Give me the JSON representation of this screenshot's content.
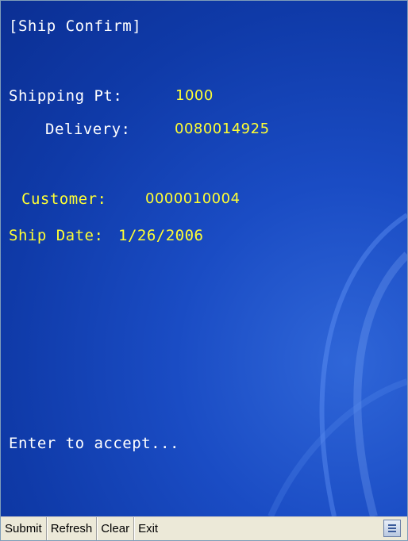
{
  "screen": {
    "title": "[Ship Confirm]",
    "shipping_pt_label": "Shipping Pt:",
    "shipping_pt_value": "1000",
    "delivery_label": "Delivery:",
    "delivery_value": "0080014925",
    "customer_label": "Customer:",
    "customer_value": "0000010004",
    "ship_date_label": "Ship Date:",
    "ship_date_value": "1/26/2006",
    "prompt": "Enter to accept..."
  },
  "taskbar": {
    "submit_label": "Submit",
    "refresh_label": "Refresh",
    "clear_label": "Clear",
    "exit_label": "Exit",
    "input_panel_icon": "keyboard-icon"
  },
  "colors": {
    "background": "#1a4cc4",
    "label_text": "#ffffff",
    "value_text": "#ffff33",
    "taskbar": "#ece9d8"
  }
}
